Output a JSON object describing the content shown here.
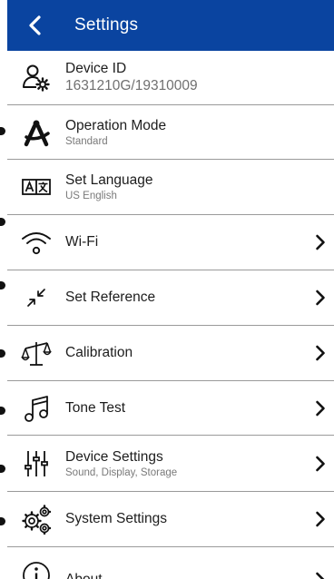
{
  "header": {
    "title": "Settings"
  },
  "rows": [
    {
      "label": "Device ID",
      "sub": "1631210G/19310009",
      "icon": "user-gear-icon"
    },
    {
      "label": "Operation Mode",
      "sub": "Standard",
      "icon": "compass-icon"
    },
    {
      "label": "Set Language",
      "sub": "US English",
      "icon": "translate-icon"
    },
    {
      "label": "Wi-Fi",
      "icon": "wifi-icon"
    },
    {
      "label": "Set Reference",
      "icon": "collapse-arrows-icon"
    },
    {
      "label": "Calibration",
      "icon": "scale-icon"
    },
    {
      "label": "Tone Test",
      "icon": "music-note-icon"
    },
    {
      "label": "Device Settings",
      "sub": "Sound, Display, Storage",
      "icon": "sliders-icon"
    },
    {
      "label": "System Settings",
      "icon": "gears-icon"
    },
    {
      "label": "About",
      "icon": "info-icon"
    }
  ],
  "colors": {
    "header": "#0a44a0",
    "divider": "#9a9a9a"
  }
}
